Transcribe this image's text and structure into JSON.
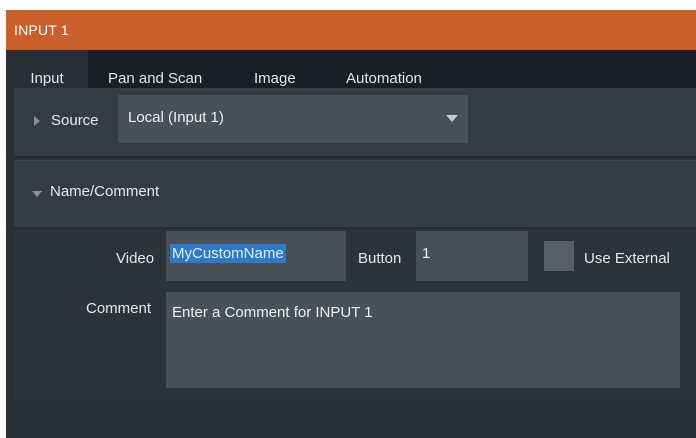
{
  "window": {
    "title": "INPUT 1"
  },
  "tabs": [
    {
      "label": "Input",
      "active": true
    },
    {
      "label": "Pan and Scan",
      "active": false
    },
    {
      "label": "Image",
      "active": false
    },
    {
      "label": "Automation",
      "active": false
    }
  ],
  "source": {
    "label": "Source",
    "selected": "Local (Input 1)"
  },
  "name_comment": {
    "header": "Name/Comment",
    "video_label": "Video",
    "video_value": "MyCustomName",
    "button_label": "Button",
    "button_value": "1",
    "use_external_label": "Use External",
    "use_external_checked": false,
    "comment_label": "Comment",
    "comment_placeholder": "Enter a Comment for INPUT 1"
  },
  "colors": {
    "title_bar": "#c9602c",
    "selection": "#2f79c6"
  }
}
